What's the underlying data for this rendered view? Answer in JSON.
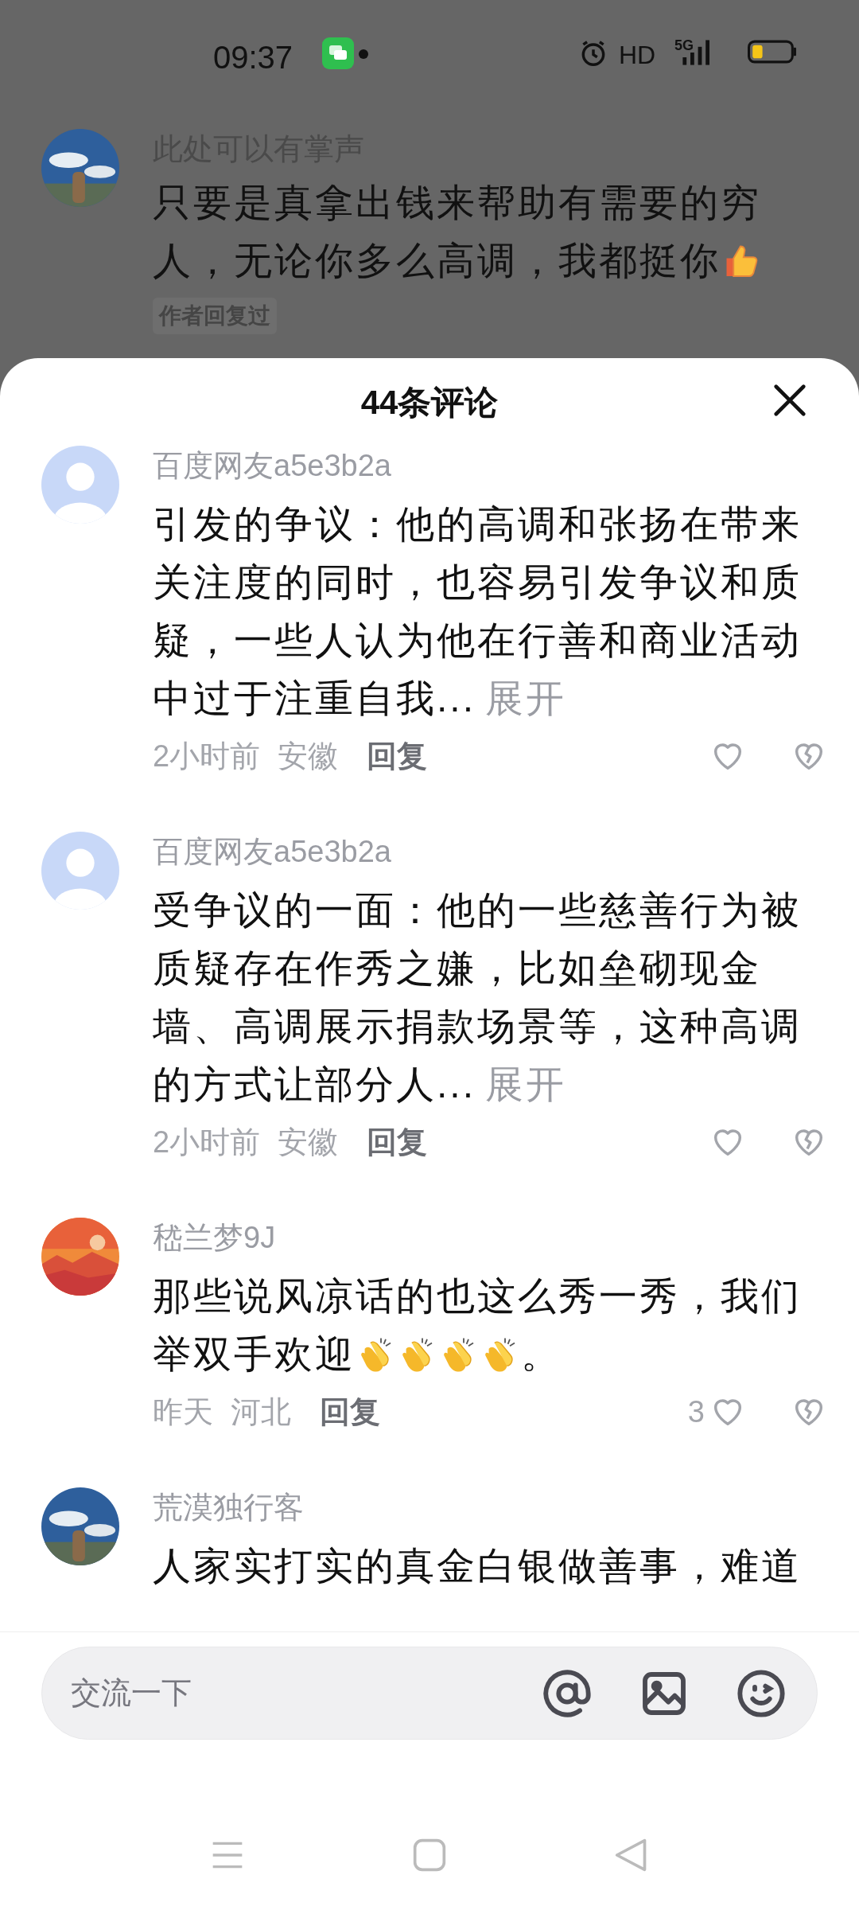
{
  "status_bar": {
    "time": "09:37",
    "hd": "HD",
    "network": "5G"
  },
  "background_comment": {
    "avatar": {
      "kind": "picture"
    },
    "name": "此处可以有掌声",
    "body": [
      {
        "kind": "text",
        "text": "只要是真拿出钱来帮助有需要的穷人，无论你多么高调，我都挺你"
      },
      {
        "kind": "thumbs-up"
      }
    ],
    "tag": "作者回复过"
  },
  "sheet": {
    "title": "44条评论"
  },
  "comments": [
    {
      "avatar": {
        "kind": "default"
      },
      "name": "百度网友a5e3b2a",
      "body": [
        {
          "kind": "text",
          "text": "引发的争议：他的高调和张扬在带来关注度的同时，也容易引发争议和质疑，一些人认为他在行善和商业活动中过于注重自我..."
        }
      ],
      "expand": "展开",
      "time": "2小时前",
      "location": "安徽",
      "reply": "回复"
    },
    {
      "avatar": {
        "kind": "default"
      },
      "name": "百度网友a5e3b2a",
      "body": [
        {
          "kind": "text",
          "text": "受争议的一面：他的一些慈善行为被质疑存在作秀之嫌，比如垒砌现金墙、高调展示捐款场景等，这种高调的方式让部分人..."
        }
      ],
      "expand": "展开",
      "time": "2小时前",
      "location": "安徽",
      "reply": "回复"
    },
    {
      "avatar": {
        "kind": "sunset"
      },
      "name": "嵇兰梦9J",
      "body": [
        {
          "kind": "text",
          "text": "那些说风凉话的也这么秀一秀，我们举双手欢迎"
        },
        {
          "kind": "clap"
        },
        {
          "kind": "clap"
        },
        {
          "kind": "clap"
        },
        {
          "kind": "clap"
        },
        {
          "kind": "text",
          "text": "。"
        }
      ],
      "time": "昨天",
      "location": "河北",
      "reply": "回复",
      "likes": "3"
    },
    {
      "avatar": {
        "kind": "picture"
      },
      "name": "荒漠独行客",
      "body": [
        {
          "kind": "text",
          "text": "人家实打实的真金白银做善事，难道"
        }
      ]
    }
  ],
  "input": {
    "placeholder": "交流一下"
  }
}
